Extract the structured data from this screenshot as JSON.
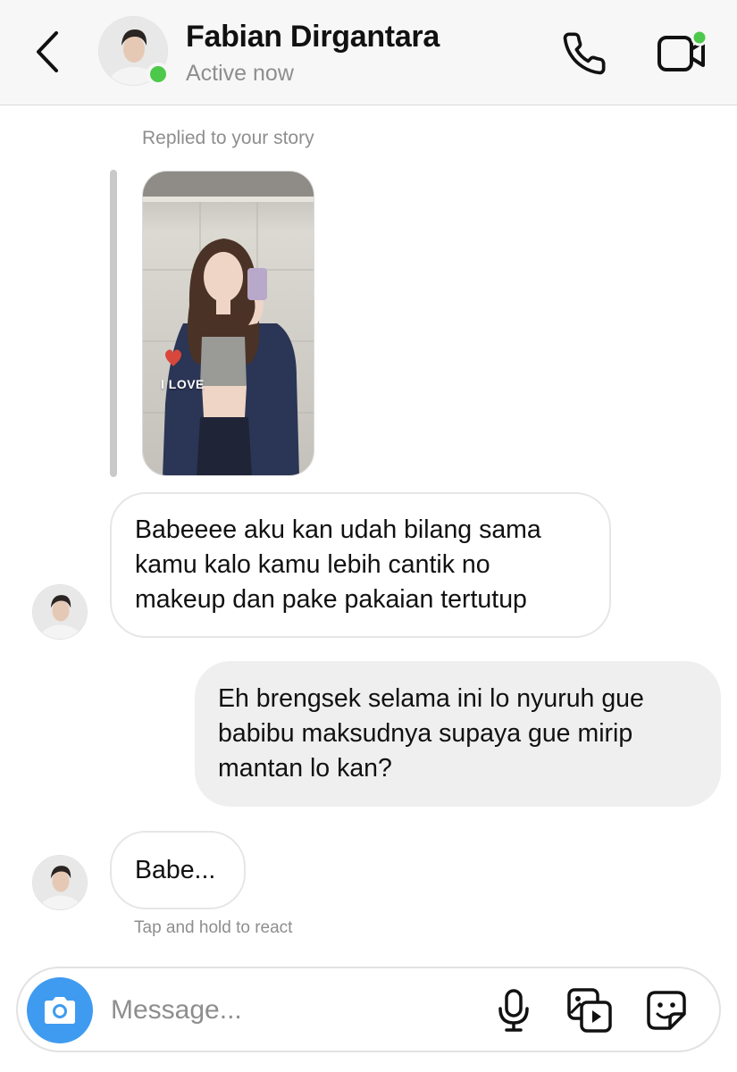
{
  "header": {
    "contact_name": "Fabian Dirgantara",
    "status": "Active now",
    "icons": {
      "back": "chevron-left-icon",
      "call": "phone-icon",
      "video": "video-camera-icon"
    },
    "online_color": "#4cc94a"
  },
  "story_reply": {
    "caption": "Replied to your story",
    "sticker_text": "I LOVE"
  },
  "messages": [
    {
      "sender": "contact",
      "lines": [
        "Babeeee aku kan udah bilang sama",
        "kamu kalo kamu lebih cantik no",
        "makeup dan pake pakaian tertutup"
      ]
    },
    {
      "sender": "me",
      "lines": [
        "Eh brengsek selama ini lo nyuruh gue",
        "babibu maksudnya supaya gue mirip",
        "mantan lo kan?"
      ]
    },
    {
      "sender": "contact",
      "lines": [
        "Babe..."
      ]
    }
  ],
  "hint": "Tap and hold to react",
  "composer": {
    "placeholder": "Message...",
    "icons": [
      "camera-icon",
      "microphone-icon",
      "gallery-icon",
      "sticker-icon"
    ],
    "accent_color": "#3f9bf0"
  }
}
